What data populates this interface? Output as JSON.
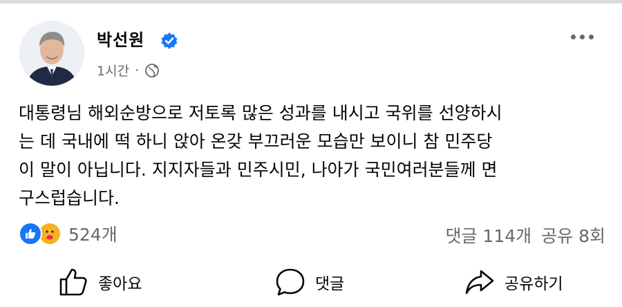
{
  "post": {
    "author": "박선원",
    "time": "1시간",
    "separator": "·",
    "text": "대통령님 해외순방으로 저토록 많은 성과를 내시고 국위를 선양하시\n는 데 국내에 떡 하니 앉아 온갖 부끄러운 모습만 보이니 참 민주당\n이 말이 아닙니다. 지지자들과 민주시민, 나아가 국민여러분들께 면\n구스럽습니다.",
    "audience_icon": "globe-icon",
    "verified_icon": "verified-badge-icon"
  },
  "stats": {
    "reactions_count": "524개",
    "comments": "댓글 114개",
    "shares": "공유 8회",
    "reaction_icons": [
      "like-reaction-icon",
      "care-reaction-icon"
    ]
  },
  "actions": {
    "like": "좋아요",
    "comment": "댓글",
    "share": "공유하기"
  },
  "colors": {
    "accent": "#1877f2",
    "secondary_text": "#65676b",
    "care": "#f7b125"
  }
}
